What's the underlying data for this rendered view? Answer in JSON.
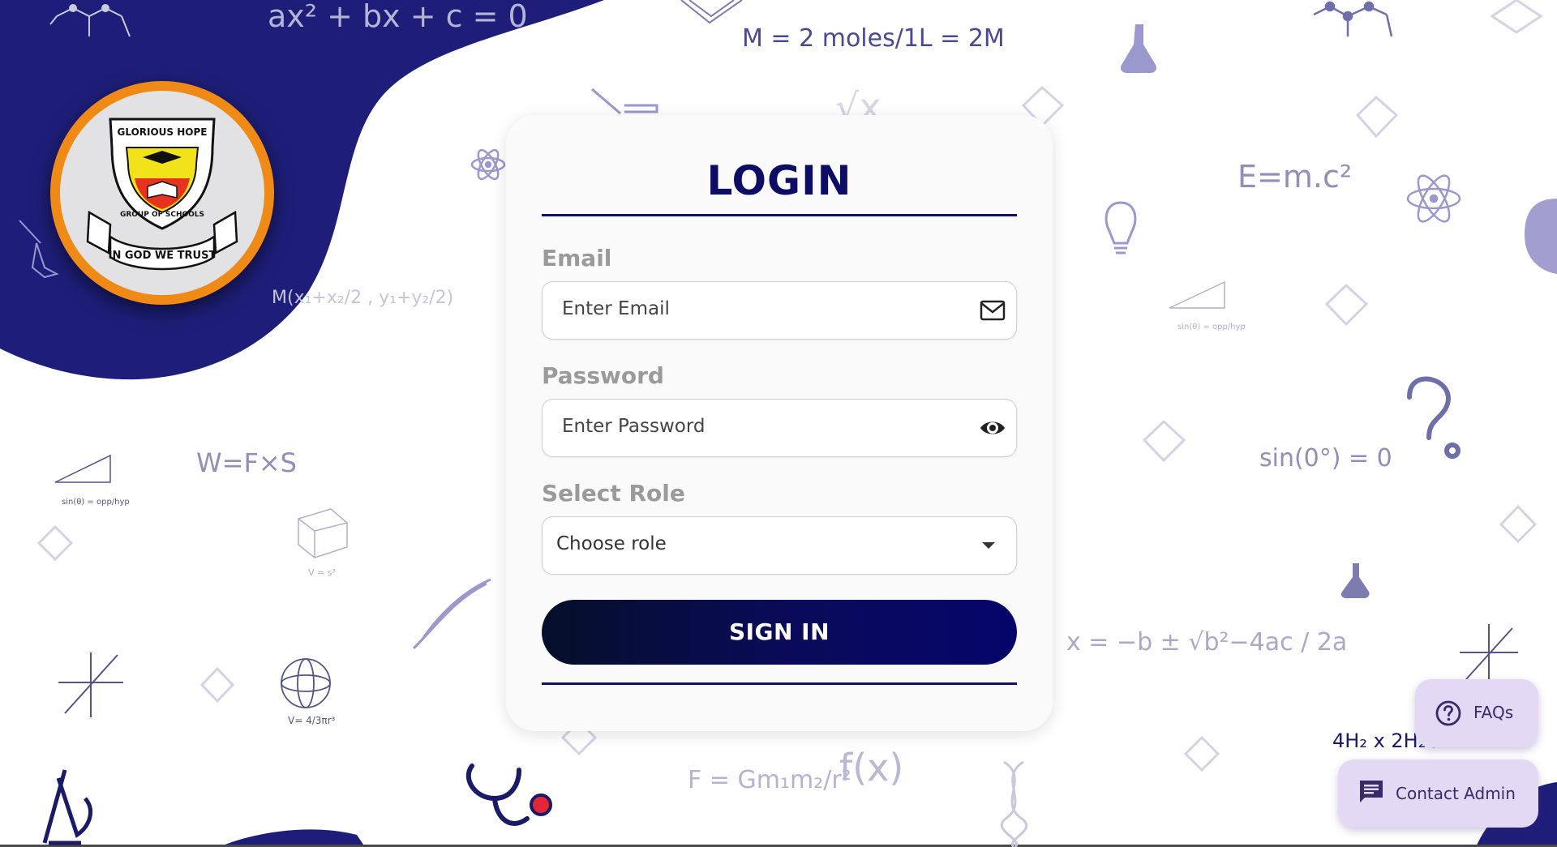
{
  "school": {
    "logo_text": "GLORIOUS HOPE",
    "motto": "IN GOD WE TRUST",
    "subtitle": "GROUP OF SCHOOLS"
  },
  "background_formulas": {
    "quadratic": "ax² + bx + c = 0",
    "molarity": "M = 2 moles/1L = 2M",
    "sqrt": "√x",
    "energy": "E=m.c²",
    "midpoint": "M(x₁+x₂/2 , y₁+y₂/2)",
    "work": "W=F×S",
    "sine_zero": "sin(0°) = 0",
    "quadratic_formula": "x = −b ± √b²−4ac / 2a",
    "gravity": "F = Gm₁m₂/r²",
    "function": "f(x)",
    "chem": "4H₂ x 2H₂O",
    "sine_def": "sin(θ) = opp/hyp",
    "volume_cube": "V = s³",
    "volume_sphere": "V= 4/3πr³"
  },
  "login": {
    "title": "LOGIN",
    "email_label": "Email",
    "email_placeholder": "Enter Email",
    "password_label": "Password",
    "password_placeholder": "Enter Password",
    "role_label": "Select Role",
    "role_value": "Choose role",
    "signin_label": "SIGN IN"
  },
  "help": {
    "faqs_label": "FAQs",
    "contact_label": "Contact Admin"
  },
  "colors": {
    "navy": "#1e1e7a",
    "title": "#0d0d66",
    "doodle": "#a9a9c9",
    "fab": "#e4d9f4",
    "logo_ring": "#f08a16"
  }
}
